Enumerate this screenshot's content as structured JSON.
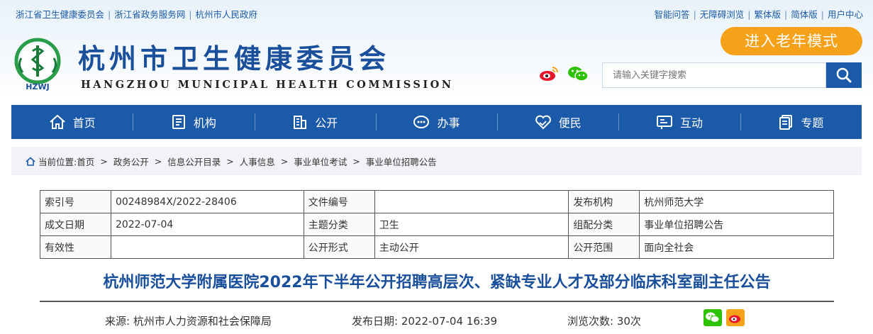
{
  "topbar": {
    "left_links": [
      "浙江省卫生健康委员会",
      "浙江省政务服务网",
      "杭州市人民政府"
    ],
    "right_links": [
      "智能问答",
      "无障碍浏览",
      "繁体版",
      "简体版",
      "用户中心"
    ],
    "separator": "|"
  },
  "header": {
    "logo_text": "HZWJ",
    "title": "杭州市卫生健康委员会",
    "subtitle": "HANGZHOU MUNICIPAL HEALTH COMMISSION",
    "elder_mode_label": "进入老年模式",
    "search_placeholder": "请输入关键字搜索"
  },
  "nav": {
    "items": [
      {
        "label": "首页",
        "icon": "home-icon"
      },
      {
        "label": "机构",
        "icon": "document-icon"
      },
      {
        "label": "公开",
        "icon": "building-icon"
      },
      {
        "label": "办事",
        "icon": "chat-dots-icon"
      },
      {
        "label": "便民",
        "icon": "handshake-heart-icon"
      },
      {
        "label": "互动",
        "icon": "dialog-icon"
      },
      {
        "label": "专题",
        "icon": "pages-icon"
      }
    ]
  },
  "breadcrumb": {
    "prefix": "当前位置:",
    "separator": ">",
    "items": [
      "首页",
      "政务公开",
      "信息公开目录",
      "人事信息",
      "事业单位考试",
      "事业单位招聘公告"
    ]
  },
  "info": {
    "rows": [
      [
        {
          "label": "索引号",
          "value": "00248984X/2022-28406"
        },
        {
          "label": "文件编号",
          "value": ""
        },
        {
          "label": "发布机构",
          "value": "杭州师范大学"
        }
      ],
      [
        {
          "label": "成文日期",
          "value": "2022-07-04"
        },
        {
          "label": "主题分类",
          "value": "卫生"
        },
        {
          "label": "组配分类",
          "value": "事业单位招聘公告"
        }
      ],
      [
        {
          "label": "有效性",
          "value": ""
        },
        {
          "label": "公开形式",
          "value": "主动公开"
        },
        {
          "label": "公开范围",
          "value": "面向全社会"
        }
      ]
    ]
  },
  "article": {
    "title": "杭州师范大学附属医院2022年下半年公开招聘高层次、紧缺专业人才及部分临床科室副主任公告",
    "source_label": "来源:",
    "source_value": "杭州市人力资源和社会保障局",
    "date_label": "发布日期:",
    "date_value": "2022-07-04 16:39",
    "views_label": "浏览次数:",
    "views_value": "30次"
  },
  "colors": {
    "primary": "#1b5aa8",
    "title_blue": "#1a4f9c",
    "accent_orange": "#f6a11a",
    "weibo_red": "#e6162d",
    "wechat_green": "#2dc100"
  }
}
